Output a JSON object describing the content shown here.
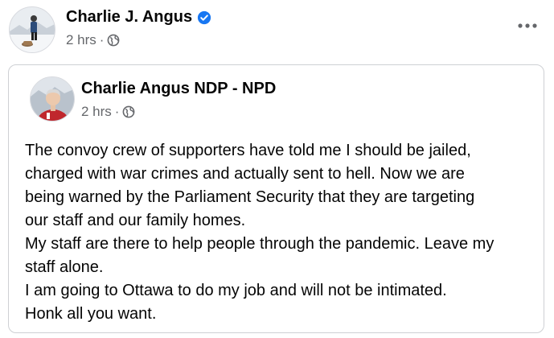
{
  "post": {
    "author_name": "Charlie J. Angus",
    "timestamp": "2 hrs",
    "separator": "·",
    "verified_icon": "verified-badge-icon",
    "privacy_icon": "globe-icon",
    "more_icon": "more-options-icon",
    "colors": {
      "verified": "#1877f2",
      "meta_text": "#65676b",
      "card_border": "#ced0d4"
    }
  },
  "shared_post": {
    "author_name": "Charlie Angus NDP - NPD",
    "timestamp": "2 hrs",
    "separator": "·",
    "privacy_icon": "globe-icon",
    "body_lines": [
      "The convoy crew of supporters have told me I should be jailed,",
      "charged with war crimes and actually sent to hell. Now we are",
      "being warned by the Parliament Security that they are targeting",
      "our staff and our family homes.",
      "My staff are there to help people through the pandemic. Leave my",
      "staff alone.",
      "I am going to Ottawa to do my job and will not be intimated.",
      "Honk all you want."
    ]
  }
}
